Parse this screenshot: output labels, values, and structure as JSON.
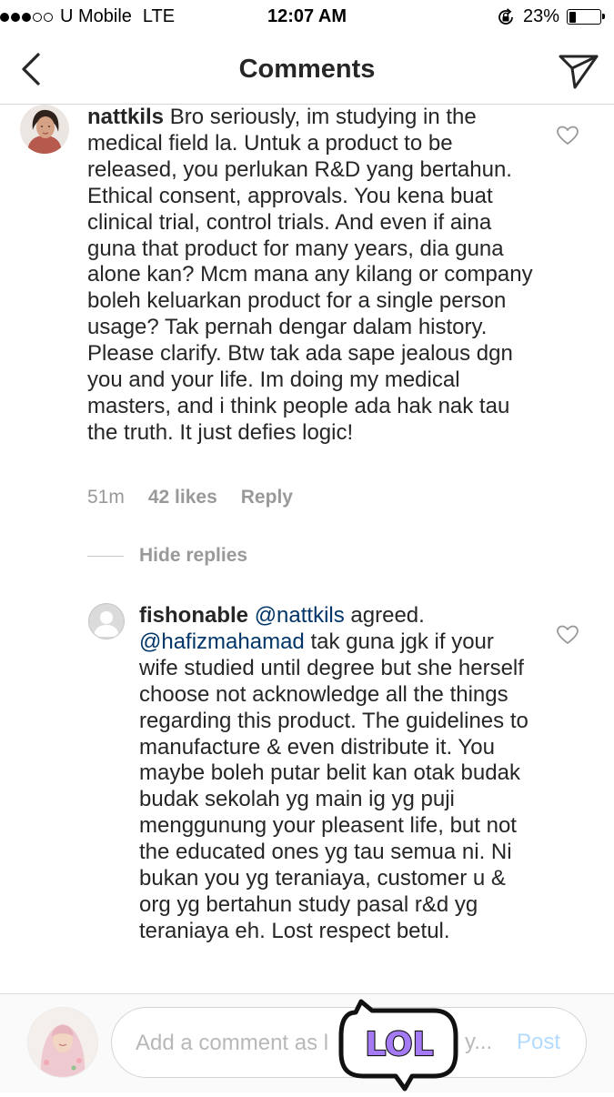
{
  "status_bar": {
    "carrier": "U Mobile",
    "network": "LTE",
    "time": "12:07 AM",
    "battery_percent_label": "23%",
    "battery_level": 0.23,
    "signal_bars_filled": 3,
    "signal_bars_total": 5
  },
  "header": {
    "title": "Comments",
    "back_icon": "chevron-left-icon",
    "share_icon": "paper-plane-icon"
  },
  "comments": [
    {
      "username": "nattkils",
      "text": " Bro seriously, im studying in the medical field la. Untuk a product to be released, you perlukan R&D yang bertahun. Ethical consent, approvals. You kena buat clinical trial, control trials. And even if aina guna that product for many years, dia guna alone kan? Mcm mana any kilang or company boleh keluarkan product for a single person usage? Tak pernah dengar dalam history. Please clarify. Btw tak ada sape jealous dgn you and your life. Im doing my medical masters, and i think people ada hak nak tau the truth. It just defies logic!",
      "time": "51m",
      "likes": "42 likes",
      "reply_label": "Reply",
      "hide_replies_label": "Hide replies"
    },
    {
      "username": "fishonable",
      "mention_1": "@nattkils",
      "text_1": " agreed. ",
      "mention_2": "@hafizmahamad",
      "text_2": " tak guna jgk if your wife studied until degree but she herself choose not acknowledge all the things regarding this product. The guidelines to manufacture & even distribute it. You maybe boleh putar belit kan otak budak budak sekolah yg main ig yg puji menggunung your pleasent life, but not the educated ones yg tau semua ni. Ni bukan you yg teraniaya, customer u & org yg bertahun study pasal r&d yg teraniaya eh. Lost respect betul."
    }
  ],
  "composer": {
    "placeholder": "Add a comment as l",
    "ellipsis": "y...",
    "post_label": "Post"
  },
  "sticker": {
    "text": "LOL"
  },
  "colors": {
    "text": "#262626",
    "meta": "#999999",
    "mention": "#003569",
    "post_disabled": "#b3dbff",
    "sticker_purple": "#a57af5",
    "sticker_green": "#9ff07a"
  }
}
